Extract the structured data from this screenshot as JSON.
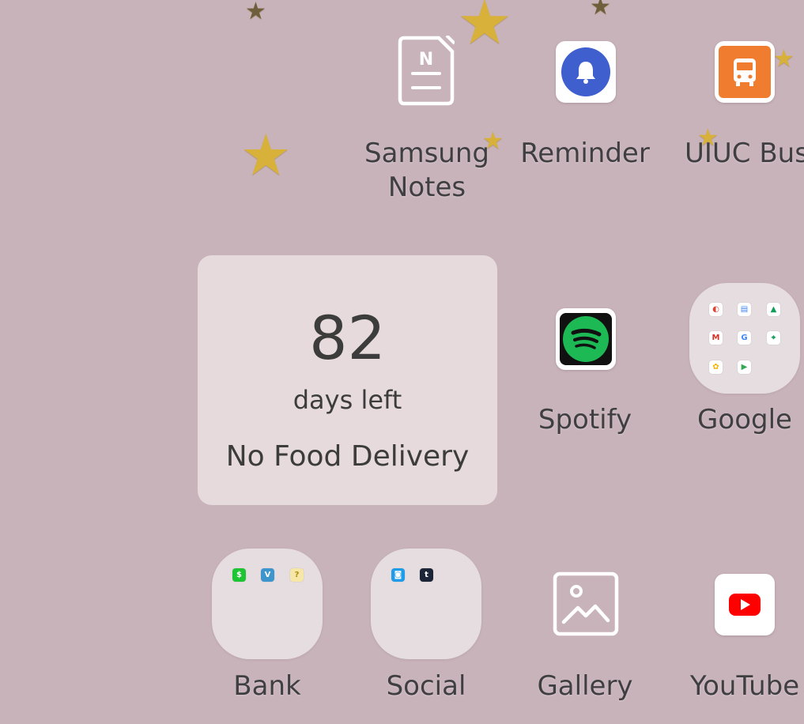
{
  "apps": {
    "samsung_notes": {
      "label_line1": "Samsung",
      "label_line2": "Notes",
      "icon": "samsung-notes-icon"
    },
    "reminder": {
      "label": "Reminder",
      "icon": "bell-icon",
      "color": "#3f5fcf"
    },
    "uiuc_bus": {
      "label": "UIUC Bus",
      "icon": "bus-icon",
      "color": "#f07d2f"
    },
    "spotify": {
      "label": "Spotify",
      "icon": "spotify-icon",
      "color": "#1db954"
    },
    "google": {
      "label": "Google",
      "icon": "folder-icon"
    },
    "bank": {
      "label": "Bank",
      "icon": "folder-icon"
    },
    "social": {
      "label": "Social",
      "icon": "folder-icon"
    },
    "gallery": {
      "label": "Gallery",
      "icon": "image-icon"
    },
    "youtube": {
      "label": "YouTube",
      "icon": "youtube-icon",
      "color": "#ff0000"
    }
  },
  "widget": {
    "count": "82",
    "unit": "days left",
    "title": "No Food Delivery"
  },
  "google_folder_glyphs": [
    "◐",
    "▤",
    "▲",
    "M",
    "G",
    "⌖",
    "✿",
    "▶"
  ],
  "bank_folder_glyphs": [
    "$",
    "V",
    "?"
  ],
  "social_folder_glyphs": [
    "◙",
    "t"
  ],
  "background_color": "#c9b3bb"
}
